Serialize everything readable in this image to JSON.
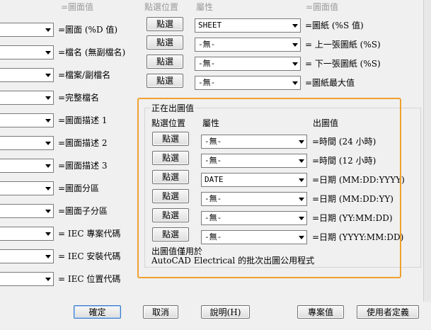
{
  "headers": {
    "left_value": "=圖面值",
    "select_pos": "點選位置",
    "attribute": "屬性",
    "right_value": "=圖面值"
  },
  "left_rows": [
    {
      "label": "=圖面 (%D 值)"
    },
    {
      "label": "=檔名 (無副檔名)"
    },
    {
      "label": "=檔案/副檔名"
    },
    {
      "label": "=完整檔名"
    },
    {
      "label": "=圖面描述 1"
    },
    {
      "label": "=圖面描述 2"
    },
    {
      "label": "=圖面描述 3"
    },
    {
      "label": "=圖面分區"
    },
    {
      "label": "=圖面子分區"
    },
    {
      "label": "= IEC 專案代碼"
    },
    {
      "label": "= IEC 安裝代碼"
    },
    {
      "label": "= IEC 位置代碼"
    }
  ],
  "top_rows": [
    {
      "button": "點選",
      "value": "SHEET",
      "label": "=圖紙 (%S 值)"
    },
    {
      "button": "點選",
      "value": "-無-",
      "label": "= 上一張圖紙 (%S)"
    },
    {
      "button": "點選",
      "value": "-無-",
      "label": "= 下一張圖紙 (%S)"
    },
    {
      "button": "點選",
      "value": "-無-",
      "label": "=圖紙最大值"
    }
  ],
  "group": {
    "title": "正在出圖值",
    "col_select": "點選位置",
    "col_attr": "屬性",
    "col_value": "出圖值",
    "rows": [
      {
        "button": "點選",
        "value": "-無-",
        "label": "=時間 (24 小時)"
      },
      {
        "button": "點選",
        "value": "-無-",
        "label": "=時間 (12 小時)"
      },
      {
        "button": "點選",
        "value": "DATE",
        "label": "=日期 (MM:DD:YYYY)"
      },
      {
        "button": "點選",
        "value": "-無-",
        "label": "=日期 (MM:DD:YY)"
      },
      {
        "button": "點選",
        "value": "-無-",
        "label": "=日期 (YY:MM:DD)"
      },
      {
        "button": "點選",
        "value": "-無-",
        "label": "=日期 (YYYY:MM:DD)"
      }
    ],
    "note_line1": "出圖值僅用於",
    "note_line2": "AutoCAD Electrical 的批次出圖公用程式"
  },
  "footer": {
    "ok": "確定",
    "cancel": "取消",
    "help": "說明(H)",
    "project_values": "專案值",
    "user_defined": "使用者定義"
  },
  "colors": {
    "highlight": "#f0a030"
  }
}
